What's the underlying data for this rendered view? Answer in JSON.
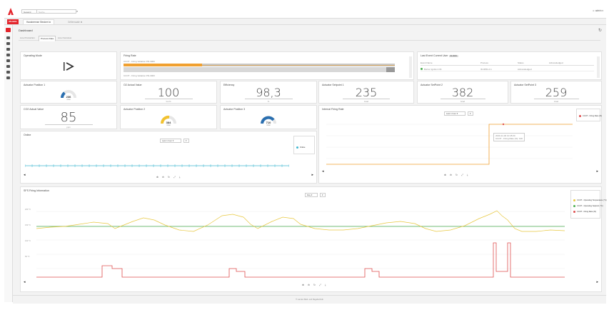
{
  "topbar": {
    "search_scope": "Gesamt",
    "search_placeholder": "Suche",
    "search_button": "⌕",
    "user": "☺ admin ▾"
  },
  "navbar": {
    "home_button": "Modelle",
    "tab_active": "Hausbremse Steckert ⚙",
    "tab_inactive": "Grillensaale ✖"
  },
  "page": {
    "title": "Dashboard",
    "subtabs": [
      "Line Production",
      "Process Data",
      "Line Overview"
    ],
    "active_subtab": 1
  },
  "cards": {
    "operating_mode": {
      "title": "Operating Mode",
      "icon": "play-skip-icon"
    },
    "firing_rate": {
      "title": "Firing Rate",
      "row1": "CCOT - Firing Variation PD-3000",
      "row2": "CCOT - Firing Variation PD-3000",
      "progress1": 0.29,
      "progress2": 0.0
    },
    "last_event": {
      "title": "Last Event Current User",
      "badge": "ID-0003",
      "cols": [
        "Event Name",
        "Process",
        "Status",
        "Acknowledged"
      ],
      "row": [
        "Burner Ignition OK",
        "ID-0051-0.1",
        "Acknowledged",
        ""
      ]
    },
    "actuator_position_1": {
      "title": "Actuator Position 1",
      "value": "236",
      "unit": "mbar"
    },
    "o2_actual": {
      "title": "O2 Actual Value",
      "value": "100",
      "unit": "Vol.%"
    },
    "efficiency": {
      "title": "Efficiency",
      "value": "98,3",
      "unit": "%"
    },
    "actuator_setpoint_1": {
      "title": "Actuator Setpoint 1",
      "value": "235",
      "unit": "Grad"
    },
    "actuator_setpoint_2": {
      "title": "Actuator SetPoint 2",
      "value": "382",
      "unit": "Grad"
    },
    "actuator_setpoint_3": {
      "title": "Actuator SetPoint 3",
      "value": "259",
      "unit": "Grad"
    },
    "co2_actual": {
      "title": "CO2 Actual Value",
      "value": "85",
      "unit": "ppm"
    },
    "actuator_position_2": {
      "title": "Actuator Position 2",
      "value": "384",
      "unit": "mbar"
    },
    "actuator_position_3": {
      "title": "Actuator Position 3",
      "value": "710",
      "unit": "mbar"
    },
    "internal_firing_rate": {
      "title": "Internal Firing Rate",
      "select": "Last 1 hour ▾",
      "legend": "CCOT - Firing Rate (%)",
      "tooltip1": "2020-11-06 10:45:00",
      "tooltip2": "CCOT - Firing Rate (%): 100"
    },
    "online": {
      "title": "Online",
      "select": "Last 1 hour ▾",
      "legend": "Online"
    },
    "sfs": {
      "title": "SFS Firing Information",
      "select": "Day ▾",
      "legend": [
        "CCOT - Operating Temperature (°C)",
        "CCOT - Operating Setpoint (°C)",
        "CCOT - Firing Rate (%)"
      ]
    }
  },
  "colors": {
    "accent": "#e3242b",
    "orange": "#f0a030",
    "yellow": "#e8c840",
    "green": "#4caf50",
    "red": "#e05050",
    "cyan": "#40b8d0"
  },
  "toolbar_icons": "⊕ ⊖ ↻ ⤢ ⤓",
  "footer": "© Lamtec Meß- und Regeltechnik"
}
